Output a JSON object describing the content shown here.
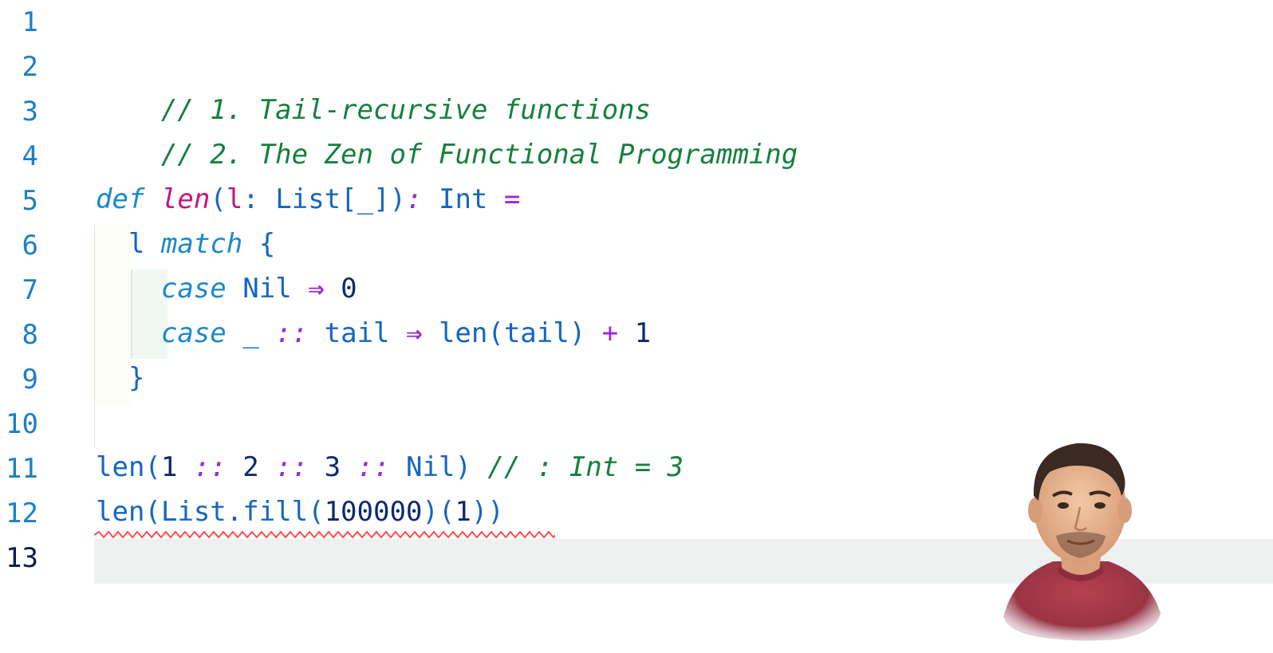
{
  "editor": {
    "line_numbers": [
      "1",
      "2",
      "3",
      "4",
      "5",
      "6",
      "7",
      "8",
      "9",
      "10",
      "11",
      "12",
      "13"
    ],
    "current_line": 13,
    "lines": {
      "l2": {
        "comment": "// 1. Tail-recursive functions"
      },
      "l3": {
        "comment": "// 2. The Zen of Functional Programming"
      },
      "l5": {
        "kw_def": "def",
        "fn_name": "len",
        "open": "(",
        "param": "l",
        "colon": ":",
        "type_list": " List[_]",
        "close": ")",
        "ret_colon": ":",
        "ret_type": " Int ",
        "eq": "="
      },
      "l6": {
        "indent": "  ",
        "ident": "l",
        "kw_match": "match",
        "brace": " {"
      },
      "l7": {
        "indent": "    ",
        "kw_case": "case",
        "pattern": " Nil ",
        "arrow": "⇒",
        "value": " 0"
      },
      "l8": {
        "indent": "    ",
        "kw_case": "case",
        "wild": " _ ",
        "cons": "::",
        "tail": " tail ",
        "arrow": "⇒",
        "call": " len(tail) ",
        "plus": "+",
        "one": " 1"
      },
      "l9": {
        "indent": "  ",
        "brace": "}"
      },
      "l11": {
        "call_open": "len(",
        "n1": "1",
        "cons1": " :: ",
        "n2": "2",
        "cons2": " :: ",
        "n3": "3",
        "cons3": " :: ",
        "nil": "Nil",
        "close": ") ",
        "result_comment": "// : Int = 3"
      },
      "l12": {
        "call_open": "len(List.fill(",
        "n_big": "100000",
        "mid": ")(",
        "n_one": "1",
        "close": "))"
      }
    },
    "error_squiggle_color": "#ff4d4d"
  }
}
